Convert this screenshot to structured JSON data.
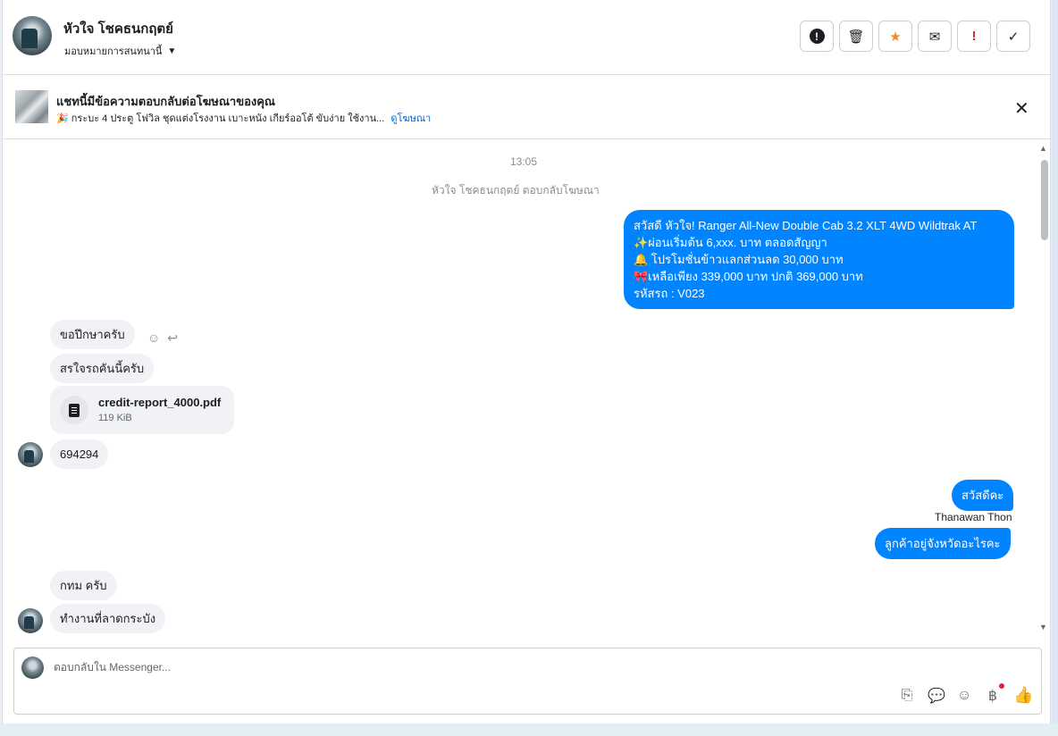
{
  "header": {
    "contact_name": "หัวใจ โชคธนกฤตย์",
    "assign_label": "มอบหมายการสนทนานี้",
    "actions": {
      "spam_icon": "!",
      "delete_icon": "🗑",
      "star_icon": "★",
      "mail_icon": "✉",
      "important_icon": "!",
      "done_icon": "✓"
    }
  },
  "ad_banner": {
    "title": "แชทนี้มีข้อความตอบกลับต่อโฆษณาของคุณ",
    "subtitle": "🎉 กระบะ 4 ประตู โฟวิล ชุดแต่งโรงงาน เบาะหนัง เกียร์ออโต้ ขับง่าย ใช้งาน...",
    "link": "ดูโฆษณา",
    "close_icon": "✕"
  },
  "chat": {
    "time": "13:05",
    "replied_note": "หัวใจ โชคธนกฤตย์ ตอบกลับโฆษณา",
    "ad_message": {
      "line1": "สวัสดี หัวใจ! Ranger All-New Double Cab 3.2 XLT 4WD Wildtrak AT",
      "line2": "✨ผ่อนเริ่มต้น 6,xxx. บาท ตลอดสัญญา",
      "line3": "🔔 โปรโมชั่นข้าวแลกส่วนลด 30,000 บาท",
      "line4": "🎀เหลือเพียง 339,000 บาท ปกติ 369,000 บาท",
      "line5": "รหัสรถ : V023"
    },
    "in_1": "ขอปึกษาครับ",
    "in_2": "สรใจรถคันนี้ครับ",
    "file": {
      "name": "credit-report_4000.pdf",
      "size": "119 KiB"
    },
    "in_3": "694294",
    "out_1": "สวัสดีคะ",
    "sender": "Thanawan Thon",
    "out_2": "ลูกค้าอยู่จังหวัดอะไรคะ",
    "in_4": "กทม  ครับ",
    "in_5": "ทำงานที่ลาดกระบัง"
  },
  "composer": {
    "placeholder": "ตอบกลับใน Messenger..."
  }
}
